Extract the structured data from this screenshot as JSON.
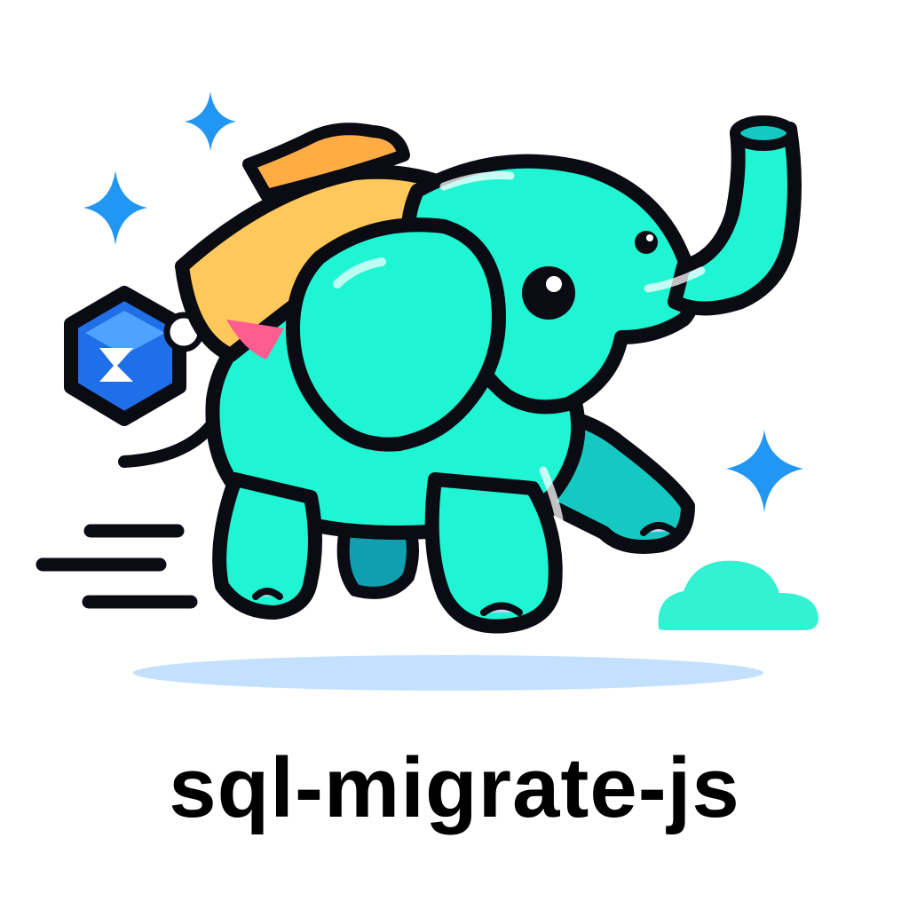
{
  "logo": {
    "title": "sql-migrate-js",
    "colors": {
      "elephant_body": "#1ff5d2",
      "elephant_shade": "#15c9c2",
      "outline": "#0b0b14",
      "blanket_orange": "#ffc85a",
      "blanket_pink": "#ff5d8f",
      "cube_blue": "#1e6fe8",
      "sparkle_blue": "#2196f3",
      "cloud": "#33f1d2",
      "shadow": "#b9dcfb",
      "toenail": "#c9cdf5"
    },
    "icons": [
      "elephant-mascot-icon",
      "sparkle-icon",
      "cube-icon",
      "cloud-icon",
      "speed-lines-icon"
    ]
  }
}
